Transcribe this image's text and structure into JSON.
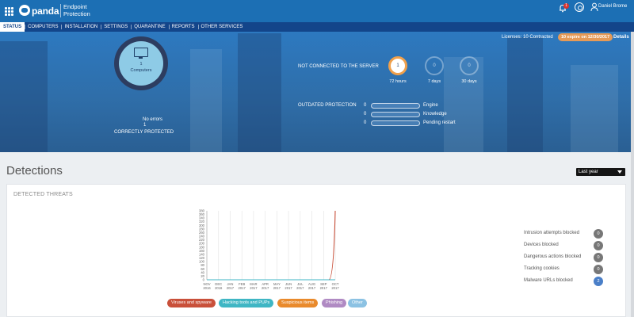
{
  "header": {
    "brand": "panda",
    "product": "Endpoint Protection",
    "notification_count": "1",
    "user_name": "Daniel Brome",
    "icons": [
      "apps-grid-icon",
      "bell-icon",
      "gear-icon",
      "user-icon"
    ]
  },
  "nav": {
    "tabs": [
      "STATUS",
      "COMPUTERS",
      "INSTALLATION",
      "SETTINGS",
      "QUARANTINE",
      "REPORTS",
      "OTHER SERVICES"
    ],
    "active": "STATUS"
  },
  "hero": {
    "licenses": "Licenses: 10 Contracted",
    "expire_badge": "10 expire on 12/30/2017",
    "details": "Details",
    "computers_count": "1",
    "computers_label": "Computers",
    "no_errors_label": "No errors",
    "no_errors_count": "1",
    "protected_label": "CORRECTLY PROTECTED",
    "not_connected_label": "NOT CONNECTED TO THE SERVER",
    "not_connected": [
      {
        "value": "1",
        "label": "72 hours",
        "active": true
      },
      {
        "value": "0",
        "label": "7 days",
        "active": false
      },
      {
        "value": "0",
        "label": "30 days",
        "active": false
      }
    ],
    "outdated_label": "OUTDATED PROTECTION",
    "outdated": [
      {
        "count": "0",
        "label": "Engine"
      },
      {
        "count": "0",
        "label": "Knowledge"
      },
      {
        "count": "0",
        "label": "Pending restart"
      }
    ]
  },
  "detections": {
    "title": "Detections",
    "period": "Last year",
    "card_title": "DETECTED THREATS",
    "stats": [
      {
        "label": "Intrusion attempts blocked",
        "value": "0"
      },
      {
        "label": "Devices blocked",
        "value": "0"
      },
      {
        "label": "Dangerous actions blocked",
        "value": "0"
      },
      {
        "label": "Tracking cookies",
        "value": "0"
      },
      {
        "label": "Malware URLs blocked",
        "value": "2"
      }
    ],
    "legend": [
      {
        "label": "Viruses and spyware",
        "color": "#c9503a"
      },
      {
        "label": "Hacking tools and PUPs",
        "color": "#3fb6c4"
      },
      {
        "label": "Suspicious items",
        "color": "#e98a2c"
      },
      {
        "label": "Phishing",
        "color": "#b08ac3"
      },
      {
        "label": "Other",
        "color": "#8cc2e3"
      }
    ]
  },
  "chart_data": {
    "type": "line",
    "categories": [
      "NOV 2016",
      "DEC 2016",
      "JAN 2017",
      "FEB 2017",
      "MAR 2017",
      "APR 2017",
      "MAY 2017",
      "JUN 2017",
      "JUL 2017",
      "AUG 2017",
      "SEP 2017",
      "OCT 2017"
    ],
    "ylim": [
      0,
      380
    ],
    "yticks": [
      0,
      20,
      40,
      60,
      80,
      100,
      120,
      140,
      160,
      180,
      200,
      220,
      240,
      260,
      280,
      300,
      320,
      340,
      360,
      380
    ],
    "series": [
      {
        "name": "Viruses and spyware",
        "color": "#c9503a",
        "values": [
          0,
          0,
          0,
          0,
          0,
          0,
          0,
          0,
          0,
          0,
          0,
          380
        ]
      },
      {
        "name": "Hacking tools and PUPs",
        "color": "#3fb6c4",
        "values": [
          0,
          0,
          0,
          0,
          0,
          0,
          0,
          0,
          0,
          0,
          0,
          0
        ]
      }
    ]
  }
}
